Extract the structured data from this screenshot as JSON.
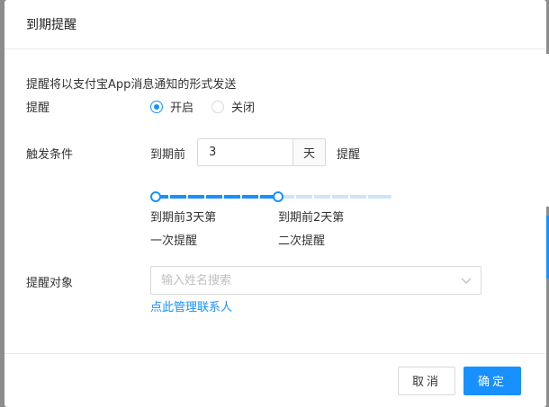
{
  "modal": {
    "title": "到期提醒",
    "description": "提醒将以支付宝App消息通知的形式发送"
  },
  "reminder": {
    "label": "提醒",
    "options": [
      {
        "label": "开启",
        "checked": true
      },
      {
        "label": "关闭",
        "checked": false
      }
    ]
  },
  "trigger": {
    "label": "触发条件",
    "prefix": "到期前",
    "value": "3",
    "unit": "天",
    "suffix": "提醒"
  },
  "slider": {
    "marks": [
      {
        "line1": "到期前3天第",
        "line2": "一次提醒"
      },
      {
        "line1": "到期前2天第",
        "line2": "二次提醒"
      }
    ]
  },
  "target": {
    "label": "提醒对象",
    "placeholder": "输入姓名搜索",
    "manage_link": "点此管理联系人"
  },
  "footer": {
    "cancel_label": "取消",
    "confirm_label": "确定"
  },
  "colors": {
    "primary": "#1890ff"
  }
}
